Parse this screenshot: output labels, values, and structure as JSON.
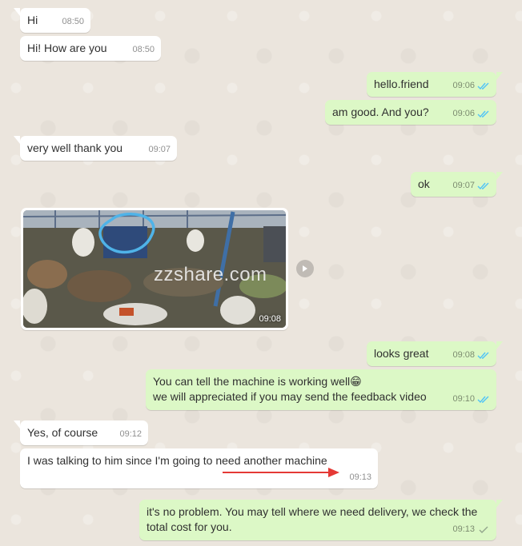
{
  "colors": {
    "incoming_bubble": "#ffffff",
    "outgoing_bubble": "#dcf8c6",
    "chat_background": "#ece5dd",
    "read_ticks": "#4fc3f7",
    "delivered_tick": "#92a58c",
    "annotation_arrow": "#e53935",
    "circle_highlight": "#4fb3e8"
  },
  "messages": [
    {
      "id": "m1",
      "dir": "in",
      "text": "Hi",
      "time": "08:50"
    },
    {
      "id": "m2",
      "dir": "in",
      "text": "Hi! How are you",
      "time": "08:50"
    },
    {
      "id": "m3",
      "dir": "out",
      "text": "hello.friend",
      "time": "09:06",
      "status": "read"
    },
    {
      "id": "m4",
      "dir": "out",
      "text": "am good. And you?",
      "time": "09:06",
      "status": "read"
    },
    {
      "id": "m5",
      "dir": "in",
      "text": "very well thank you",
      "time": "09:07"
    },
    {
      "id": "m6",
      "dir": "out",
      "text": "ok",
      "time": "09:07",
      "status": "read"
    },
    {
      "id": "m7",
      "dir": "in",
      "type": "image",
      "time": "09:08",
      "icon": "forward-icon"
    },
    {
      "id": "m8",
      "dir": "out",
      "text": "looks great",
      "time": "09:08",
      "status": "read"
    },
    {
      "id": "m9",
      "dir": "out",
      "text": "You can tell the machine is working well😁\nwe will appreciated if you may send the feedback video",
      "time": "09:10",
      "status": "read"
    },
    {
      "id": "m10",
      "dir": "in",
      "text": "Yes, of course",
      "time": "09:12"
    },
    {
      "id": "m11",
      "dir": "in",
      "text": "I was talking to him since I'm going to need another machine",
      "time": "09:13"
    },
    {
      "id": "m12",
      "dir": "out",
      "text": "it's no problem. You may tell where we need delivery, we check the total cost for you.",
      "time": "09:13",
      "status": "delivered"
    }
  ],
  "watermark": "zzshare.com"
}
